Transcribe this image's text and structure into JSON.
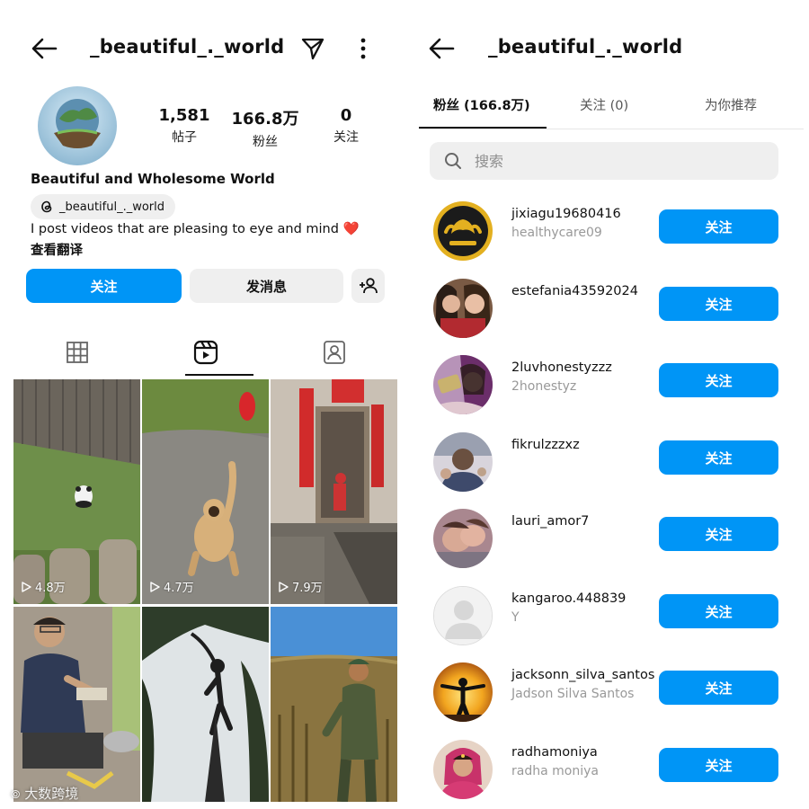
{
  "profile": {
    "username": "_beautiful_._world",
    "stats": [
      {
        "value": "1,581",
        "label": "帖子"
      },
      {
        "value": "166.8万",
        "label": "粉丝"
      },
      {
        "value": "0",
        "label": "关注"
      }
    ],
    "display_name": "Beautiful and Wholesome World",
    "threads_handle": "_beautiful_._world",
    "bio": "I post videos that are pleasing to eye and mind",
    "bio_emoji": "❤️",
    "translate_label": "查看翻译",
    "follow_label": "关注",
    "message_label": "发消息",
    "grid_views": [
      "4.8万",
      "4.7万",
      "7.9万"
    ]
  },
  "followers_page": {
    "username": "_beautiful_._world",
    "tabs": [
      {
        "label": "粉丝 (166.8万)",
        "active": true
      },
      {
        "label": "关注 (0)",
        "active": false
      },
      {
        "label": "为你推荐",
        "active": false
      }
    ],
    "search_placeholder": "搜索",
    "follow_label": "关注",
    "followers": [
      {
        "username": "jixiagu19680416",
        "subtitle": "healthycare09"
      },
      {
        "username": "estefania43592024",
        "subtitle": ""
      },
      {
        "username": "2luvhonestyzzz",
        "subtitle": "2honestyz"
      },
      {
        "username": "fikrulzzzxz",
        "subtitle": ""
      },
      {
        "username": "lauri_amor7",
        "subtitle": ""
      },
      {
        "username": "kangaroo.448839",
        "subtitle": "Y"
      },
      {
        "username": "jacksonn_silva_santos",
        "subtitle": "Jadson Silva Santos"
      },
      {
        "username": "radhamoniya",
        "subtitle": "radha moniya"
      }
    ]
  },
  "watermark": "大数跨境",
  "colors": {
    "accent": "#0095f6",
    "button_grey": "#efefef"
  },
  "icons": [
    "back-arrow-icon",
    "send-icon",
    "more-vertical-icon",
    "threads-icon",
    "add-person-icon",
    "grid-icon",
    "reels-icon",
    "tagged-icon",
    "play-icon",
    "search-icon"
  ]
}
